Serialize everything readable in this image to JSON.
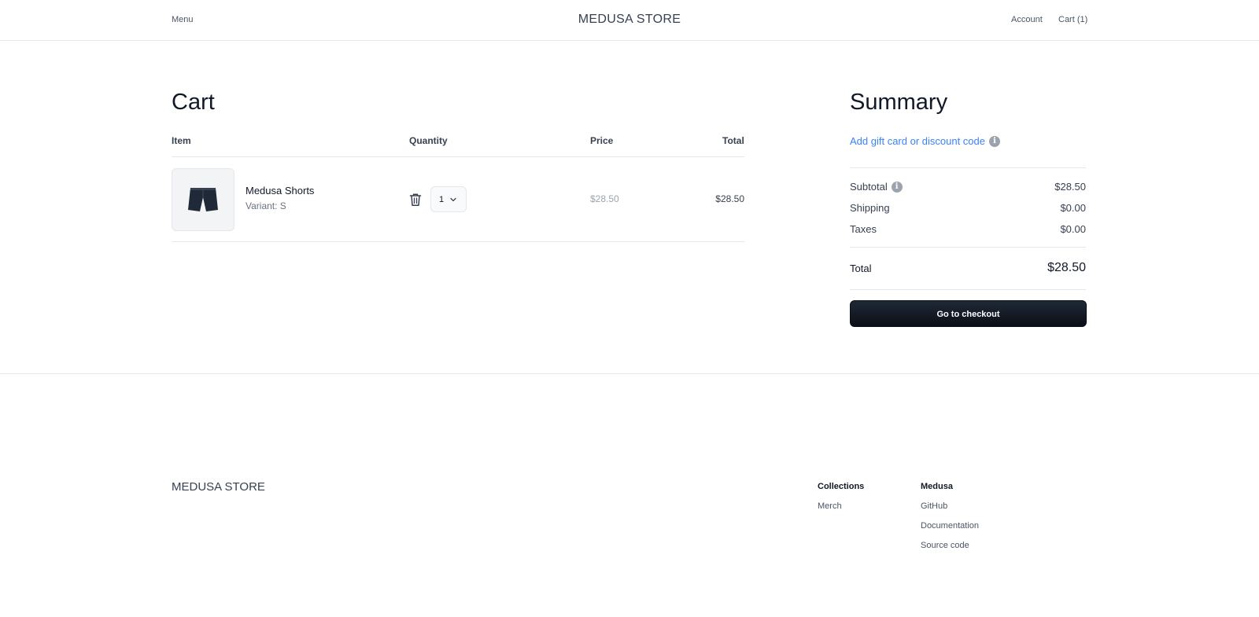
{
  "header": {
    "menu_label": "Menu",
    "brand": "MEDUSA STORE",
    "account_label": "Account",
    "cart_label": "Cart (1)"
  },
  "cart": {
    "title": "Cart",
    "columns": [
      "Item",
      "Quantity",
      "Price",
      "Total"
    ],
    "items": [
      {
        "name": "Medusa Shorts",
        "variant": "Variant: S",
        "quantity": "1",
        "price": "$28.50",
        "total": "$28.50",
        "thumbnail_icon": "shorts-icon"
      }
    ]
  },
  "summary": {
    "title": "Summary",
    "gift_card_link": "Add gift card or discount code",
    "rows": [
      {
        "label": "Subtotal",
        "value": "$28.50"
      },
      {
        "label": "Shipping",
        "value": "$0.00"
      },
      {
        "label": "Taxes",
        "value": "$0.00"
      }
    ],
    "total_label": "Total",
    "total_value": "$28.50",
    "checkout_label": "Go to checkout"
  },
  "footer": {
    "brand": "MEDUSA STORE",
    "columns": [
      {
        "heading": "Collections",
        "links": [
          "Merch"
        ]
      },
      {
        "heading": "Medusa",
        "links": [
          "GitHub",
          "Documentation",
          "Source code"
        ]
      }
    ]
  },
  "colors": {
    "accent_link": "#3b82f6",
    "checkout_button": "#111827",
    "divider": "#e5e7eb"
  }
}
